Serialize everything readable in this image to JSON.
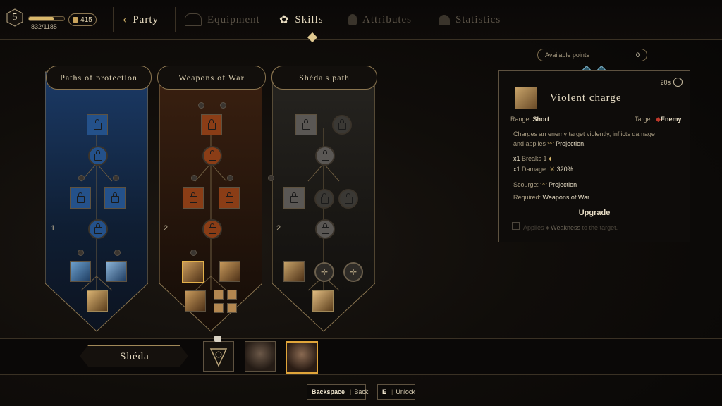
{
  "hud": {
    "level": "5",
    "xp_text": "832/1185",
    "xp_fraction": 0.7,
    "gold": "415",
    "gold_icon": "coins-icon"
  },
  "nav": {
    "back_icon": "chevron-left-icon",
    "party": "Party",
    "equipment": "Equipment",
    "skills": "Skills",
    "attributes": "Attributes",
    "statistics": "Statistics"
  },
  "trees": [
    {
      "title": "Paths of protection",
      "rows": [
        "1"
      ],
      "accent": "#1e4f86"
    },
    {
      "title": "Weapons of War",
      "rows": [
        "2"
      ],
      "accent": "#8a3d16"
    },
    {
      "title": "Shéda's path",
      "rows": [
        "2"
      ],
      "accent": "#4a4744"
    }
  ],
  "skill_panel": {
    "available_label": "Available points",
    "available_value": "0",
    "cooldown": "20s",
    "title": "Violent charge",
    "range_label": "Range:",
    "range_value": "Short",
    "target_label": "Target:",
    "target_value": "Enemy",
    "description_1": "Charges an enemy target violently, inflicts damage",
    "description_2": "and applies",
    "description_effect": "Projection.",
    "stat_1_mult": "x1",
    "stat_1_label": "Breaks 1",
    "stat_2_mult": "x1",
    "stat_2_label": "Damage:",
    "stat_2_value": "320%",
    "scourge_label": "Scourge:",
    "scourge_value": "Projection",
    "required_label": "Required:",
    "required_value": "Weapons of War",
    "upgrade_label": "Upgrade",
    "upgrade_desc_1": "Applies",
    "upgrade_desc_effect": "Weakness",
    "upgrade_desc_2": "to the target."
  },
  "party": {
    "hero_name": "Shéda"
  },
  "footer": {
    "back_key": "Backspace",
    "back_label": "Back",
    "unlock_key": "E",
    "unlock_label": "Unlock"
  }
}
